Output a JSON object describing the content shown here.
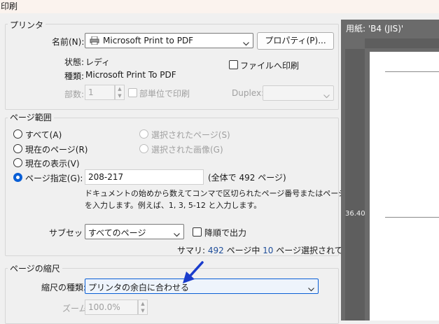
{
  "window": {
    "title": "印刷"
  },
  "printer": {
    "legend": "プリンタ",
    "name_label": "名前(N):",
    "name_value": "Microsoft Print to PDF",
    "properties_button": "プロパティ(P)...",
    "status_label": "状態:",
    "status_value": "レディ",
    "type_label": "種類:",
    "type_value": "Microsoft Print To PDF",
    "print_to_file_label": "ファイルへ印刷",
    "copies_label": "部数:",
    "copies_value": "1",
    "collate_label": "部単位で印刷",
    "duplex_label": "Duplex:"
  },
  "page_range": {
    "legend": "ページ範囲",
    "all": "すべて(A)",
    "current_page": "現在のページ(R)",
    "current_view": "現在の表示(V)",
    "pages_label": "ページ指定(G):",
    "pages_value": "208-217",
    "total": "(全体で 492 ページ)",
    "selected_pages": "選択されたページ(S)",
    "selected_images": "選択された画像(G)",
    "help_line1": "ドキュメントの始めから数えてコンマで区切られたページ番号またはページ範囲",
    "help_line2": "を入力します。例えば、1, 3, 5-12 と入力します。",
    "subset_label": "サブセット:",
    "subset_value": "すべてのページ",
    "reverse_label": "降順で出力",
    "summary_prefix": "サマリ: ",
    "summary_total": "492",
    "summary_mid": " ページ中 ",
    "summary_selected": "10",
    "summary_suffix": " ページ選択されています"
  },
  "scaling": {
    "legend": "ページの縮尺",
    "type_label": "縮尺の種類:",
    "type_value": "プリンタの余白に合わせる",
    "zoom_label": "ズーム:",
    "zoom_value": "100.0%"
  },
  "preview": {
    "paper_label": "用紙: 'B4 (JIS)'",
    "ruler_value": "36.40"
  },
  "colors": {
    "accent": "#0a5fd6",
    "annotation_arrow": "#1a3ccc"
  }
}
